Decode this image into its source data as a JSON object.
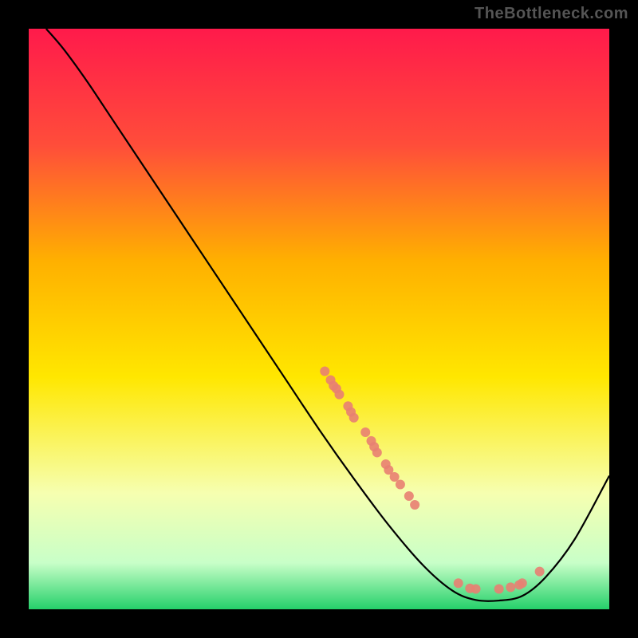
{
  "watermark": "TheBottleneck.com",
  "chart_data": {
    "type": "line",
    "title": "",
    "xlabel": "",
    "ylabel": "",
    "xlim": [
      0,
      100
    ],
    "ylim": [
      0,
      100
    ],
    "grid": false,
    "legend": false,
    "background_gradient_stops": [
      {
        "offset": 0.0,
        "color": "#ff1a4b"
      },
      {
        "offset": 0.2,
        "color": "#ff4d3a"
      },
      {
        "offset": 0.4,
        "color": "#ffb000"
      },
      {
        "offset": 0.6,
        "color": "#ffe700"
      },
      {
        "offset": 0.8,
        "color": "#f6ffb0"
      },
      {
        "offset": 0.92,
        "color": "#c8ffc8"
      },
      {
        "offset": 1.0,
        "color": "#25d06a"
      }
    ],
    "series": [
      {
        "name": "bottleneck-curve",
        "stroke": "#000000",
        "points": [
          {
            "x": 3.0,
            "y": 100.0
          },
          {
            "x": 6.0,
            "y": 96.5
          },
          {
            "x": 10.0,
            "y": 91.0
          },
          {
            "x": 14.0,
            "y": 85.0
          },
          {
            "x": 20.0,
            "y": 76.0
          },
          {
            "x": 28.0,
            "y": 64.0
          },
          {
            "x": 36.0,
            "y": 52.0
          },
          {
            "x": 44.0,
            "y": 40.0
          },
          {
            "x": 50.0,
            "y": 31.0
          },
          {
            "x": 56.0,
            "y": 22.5
          },
          {
            "x": 62.0,
            "y": 14.5
          },
          {
            "x": 68.0,
            "y": 7.5
          },
          {
            "x": 73.0,
            "y": 3.2
          },
          {
            "x": 77.0,
            "y": 1.6
          },
          {
            "x": 81.0,
            "y": 1.5
          },
          {
            "x": 85.0,
            "y": 2.3
          },
          {
            "x": 89.0,
            "y": 5.5
          },
          {
            "x": 94.0,
            "y": 12.0
          },
          {
            "x": 100.0,
            "y": 23.0
          }
        ]
      }
    ],
    "scatter": [
      {
        "name": "data-cluster",
        "x": 51.0,
        "y": 41.0
      },
      {
        "name": "data-cluster",
        "x": 52.0,
        "y": 39.5
      },
      {
        "name": "data-cluster",
        "x": 52.5,
        "y": 38.5
      },
      {
        "name": "data-cluster",
        "x": 53.0,
        "y": 38.0
      },
      {
        "name": "data-cluster",
        "x": 53.5,
        "y": 37.0
      },
      {
        "name": "data-cluster",
        "x": 55.0,
        "y": 35.0
      },
      {
        "name": "data-cluster",
        "x": 55.5,
        "y": 34.0
      },
      {
        "name": "data-cluster",
        "x": 56.0,
        "y": 33.0
      },
      {
        "name": "data-cluster",
        "x": 58.0,
        "y": 30.5
      },
      {
        "name": "data-cluster",
        "x": 59.0,
        "y": 29.0
      },
      {
        "name": "data-cluster",
        "x": 59.5,
        "y": 28.0
      },
      {
        "name": "data-cluster",
        "x": 60.0,
        "y": 27.0
      },
      {
        "name": "data-cluster",
        "x": 61.5,
        "y": 25.0
      },
      {
        "name": "data-cluster",
        "x": 62.0,
        "y": 24.0
      },
      {
        "name": "data-cluster",
        "x": 63.0,
        "y": 22.8
      },
      {
        "name": "data-cluster",
        "x": 64.0,
        "y": 21.5
      },
      {
        "name": "data-cluster",
        "x": 65.5,
        "y": 19.5
      },
      {
        "name": "data-cluster",
        "x": 66.5,
        "y": 18.0
      },
      {
        "name": "data-cluster",
        "x": 74.0,
        "y": 4.5
      },
      {
        "name": "data-cluster",
        "x": 76.0,
        "y": 3.6
      },
      {
        "name": "data-cluster",
        "x": 77.0,
        "y": 3.5
      },
      {
        "name": "data-cluster",
        "x": 81.0,
        "y": 3.5
      },
      {
        "name": "data-cluster",
        "x": 83.0,
        "y": 3.8
      },
      {
        "name": "data-cluster",
        "x": 84.5,
        "y": 4.2
      },
      {
        "name": "data-cluster",
        "x": 85.0,
        "y": 4.5
      },
      {
        "name": "data-cluster",
        "x": 88.0,
        "y": 6.5
      }
    ],
    "scatter_color": "#e87f72"
  }
}
